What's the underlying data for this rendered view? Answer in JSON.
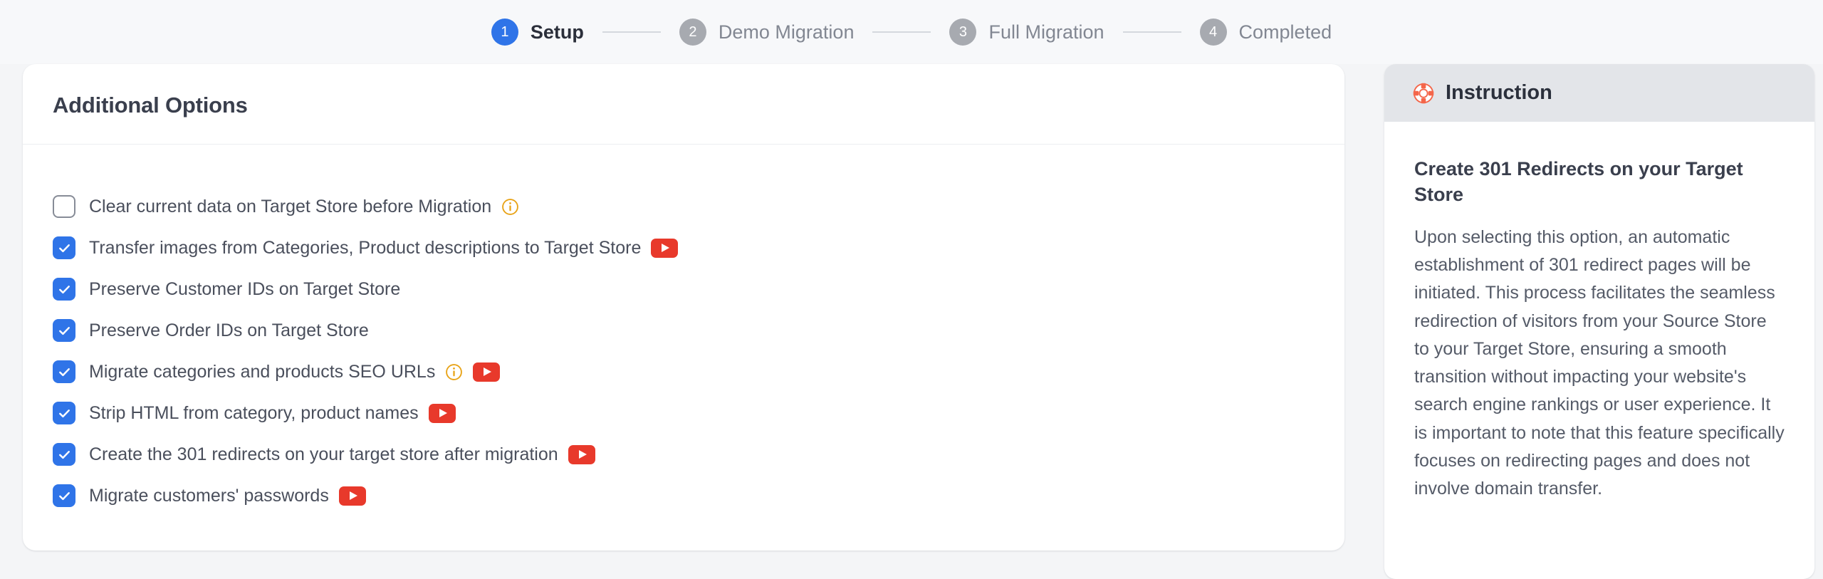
{
  "stepper": {
    "steps": [
      {
        "number": "1",
        "label": "Setup",
        "state": "active"
      },
      {
        "number": "2",
        "label": "Demo Migration",
        "state": "inactive"
      },
      {
        "number": "3",
        "label": "Full Migration",
        "state": "inactive"
      },
      {
        "number": "4",
        "label": "Completed",
        "state": "inactive"
      }
    ]
  },
  "main": {
    "title": "Additional Options",
    "options": [
      {
        "label": "Clear current data on Target Store before Migration",
        "checked": false,
        "info": true,
        "video": false
      },
      {
        "label": "Transfer images from Categories, Product descriptions to Target Store",
        "checked": true,
        "info": false,
        "video": true
      },
      {
        "label": "Preserve Customer IDs on Target Store",
        "checked": true,
        "info": false,
        "video": false
      },
      {
        "label": "Preserve Order IDs on Target Store",
        "checked": true,
        "info": false,
        "video": false
      },
      {
        "label": "Migrate categories and products SEO URLs",
        "checked": true,
        "info": true,
        "video": true
      },
      {
        "label": "Strip HTML from category, product names",
        "checked": true,
        "info": false,
        "video": true
      },
      {
        "label": "Create the 301 redirects on your target store after migration",
        "checked": true,
        "info": false,
        "video": true
      },
      {
        "label": "Migrate customers' passwords",
        "checked": true,
        "info": false,
        "video": true
      }
    ]
  },
  "instruction": {
    "header_title": "Instruction",
    "header_icon": "lifebuoy-icon",
    "title": "Create 301 Redirects on your Target Store",
    "text": "Upon selecting this option, an automatic establishment of 301 redirect pages will be initiated. This process facilitates the seamless redirection of visitors from your Source Store to your Target Store, ensuring a smooth transition without impacting your website's search engine rankings or user experience. It is important to note that this feature specifically focuses on redirecting pages and does not involve domain transfer."
  },
  "colors": {
    "accent_blue": "#2f74e8",
    "inactive_gray": "#a7aab0",
    "info_orange": "#e8a317",
    "youtube_red": "#e8392b",
    "lifebuoy_red": "#f4664a",
    "page_bg": "#f4f5f7",
    "panel_header_bg": "#e3e5e9"
  }
}
